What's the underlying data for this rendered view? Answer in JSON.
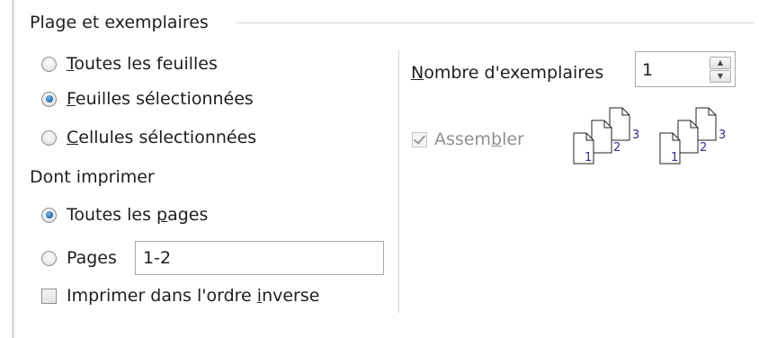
{
  "range": {
    "title": "Plage et exemplaires",
    "options": [
      {
        "pre": "",
        "key": "T",
        "post": "outes les feuilles",
        "checked": false
      },
      {
        "pre": "",
        "key": "F",
        "post": "euilles sélectionnées",
        "checked": true
      },
      {
        "pre": "",
        "key": "C",
        "post": "ellules sélectionnées",
        "checked": false
      }
    ]
  },
  "print_pages": {
    "label": "Dont imprimer",
    "all_pages": {
      "pre": "Toutes les ",
      "key": "p",
      "post": "ages",
      "checked": true
    },
    "pages": {
      "label": "Pages",
      "checked": false,
      "value": "1-2"
    },
    "reverse": {
      "pre": "Imprimer dans l'ordre ",
      "key": "i",
      "post": "nverse",
      "checked": false
    }
  },
  "copies": {
    "label_key": "N",
    "label_rest": "ombre d'exemplaires",
    "value": "1",
    "up_icon": "triangle-up-icon",
    "down_icon": "triangle-down-icon"
  },
  "collate": {
    "pre": "Assem",
    "key": "b",
    "post": "ler",
    "checked": true,
    "enabled": false,
    "illustration_pages": [
      "1",
      "2",
      "3"
    ]
  },
  "colors": {
    "radio_selected": "#2f79bb",
    "disabled_text": "#8f8f8f",
    "page_number": "#3b2a8a"
  }
}
